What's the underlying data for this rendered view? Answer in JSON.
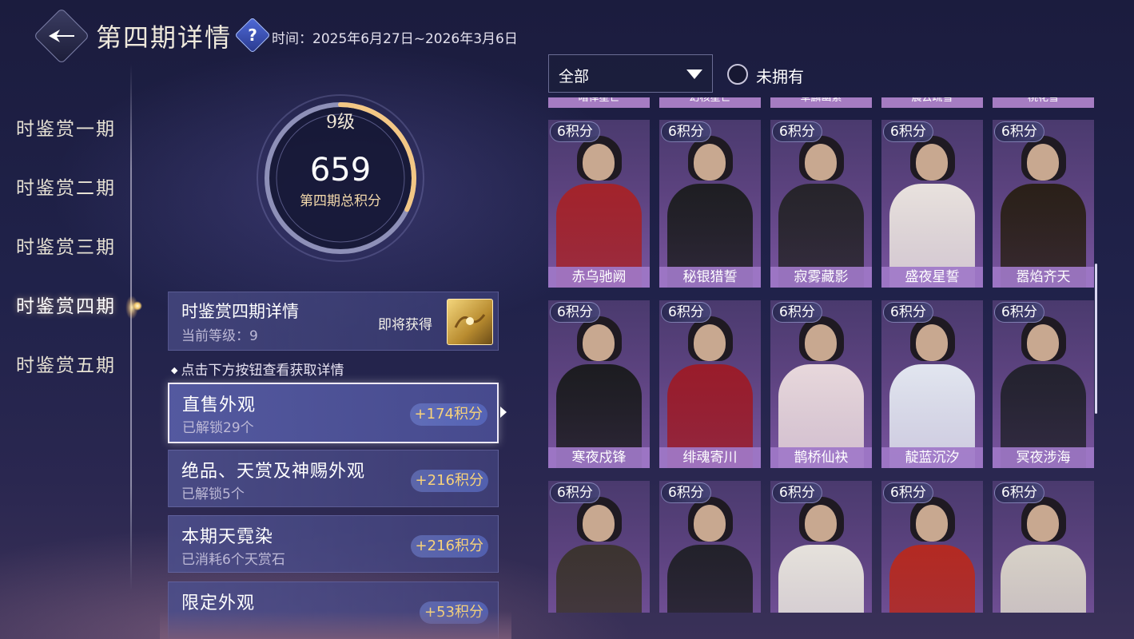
{
  "header": {
    "title": "第四期详情",
    "help_icon": "question-diamond-icon",
    "time_text": "时间：2025年6月27日~2026年3月6日"
  },
  "side_nav": {
    "items": [
      {
        "label": "时鉴赏一期",
        "active": false
      },
      {
        "label": "时鉴赏二期",
        "active": false
      },
      {
        "label": "时鉴赏三期",
        "active": false
      },
      {
        "label": "时鉴赏四期",
        "active": true
      },
      {
        "label": "时鉴赏五期",
        "active": false
      }
    ]
  },
  "score": {
    "level": "9级",
    "value": "659",
    "caption": "第四期总积分",
    "progress": 0.32
  },
  "detail": {
    "title": "时鉴赏四期详情",
    "current_level": "当前等级：9",
    "soon_label": "即将获得"
  },
  "hint": "点击下方按钮查看获取详情",
  "categories": [
    {
      "name": "直售外观",
      "sub": "已解锁29个",
      "points": "+174积分",
      "active": true
    },
    {
      "name": "绝品、天赏及神赐外观",
      "sub": "已解锁5个",
      "points": "+216积分",
      "active": false
    },
    {
      "name": "本期天霓染",
      "sub": "已消耗6个天赏石",
      "points": "+216积分",
      "active": false
    },
    {
      "name": "限定外观",
      "sub": "",
      "points": "+53积分",
      "active": false
    }
  ],
  "filter": {
    "selected": "全部",
    "unowned_label": "未拥有",
    "unowned_checked": false
  },
  "top_strip_names": [
    "暗律星芒",
    "幻核星芒",
    "草麟幽素",
    "晨云疏雪",
    "桃花雪"
  ],
  "outfits": [
    {
      "name": "赤乌驰阙",
      "points": "6积分",
      "color": "#a3232b"
    },
    {
      "name": "秘银猎誓",
      "points": "6积分",
      "color": "#1e1e22"
    },
    {
      "name": "寂雾藏影",
      "points": "6积分",
      "color": "#26242a"
    },
    {
      "name": "盛夜星誓",
      "points": "6积分",
      "color": "#e9e2de"
    },
    {
      "name": "嚣焰齐天",
      "points": "6积分",
      "color": "#2a2018"
    },
    {
      "name": "寒夜戍锋",
      "points": "6积分",
      "color": "#1c1c20"
    },
    {
      "name": "绯魂寄川",
      "points": "6积分",
      "color": "#9a1c2a"
    },
    {
      "name": "鹊桥仙袂",
      "points": "6积分",
      "color": "#e8d8dc"
    },
    {
      "name": "靛蓝沉汐",
      "points": "6积分",
      "color": "#e2e6f0"
    },
    {
      "name": "冥夜涉海",
      "points": "6积分",
      "color": "#23222e"
    },
    {
      "name": "",
      "points": "6积分",
      "color": "#3c3430"
    },
    {
      "name": "",
      "points": "6积分",
      "color": "#22212a"
    },
    {
      "name": "",
      "points": "6积分",
      "color": "#e6e2dc"
    },
    {
      "name": "",
      "points": "6积分",
      "color": "#b42a22"
    },
    {
      "name": "",
      "points": "6积分",
      "color": "#d8d2c8"
    }
  ]
}
